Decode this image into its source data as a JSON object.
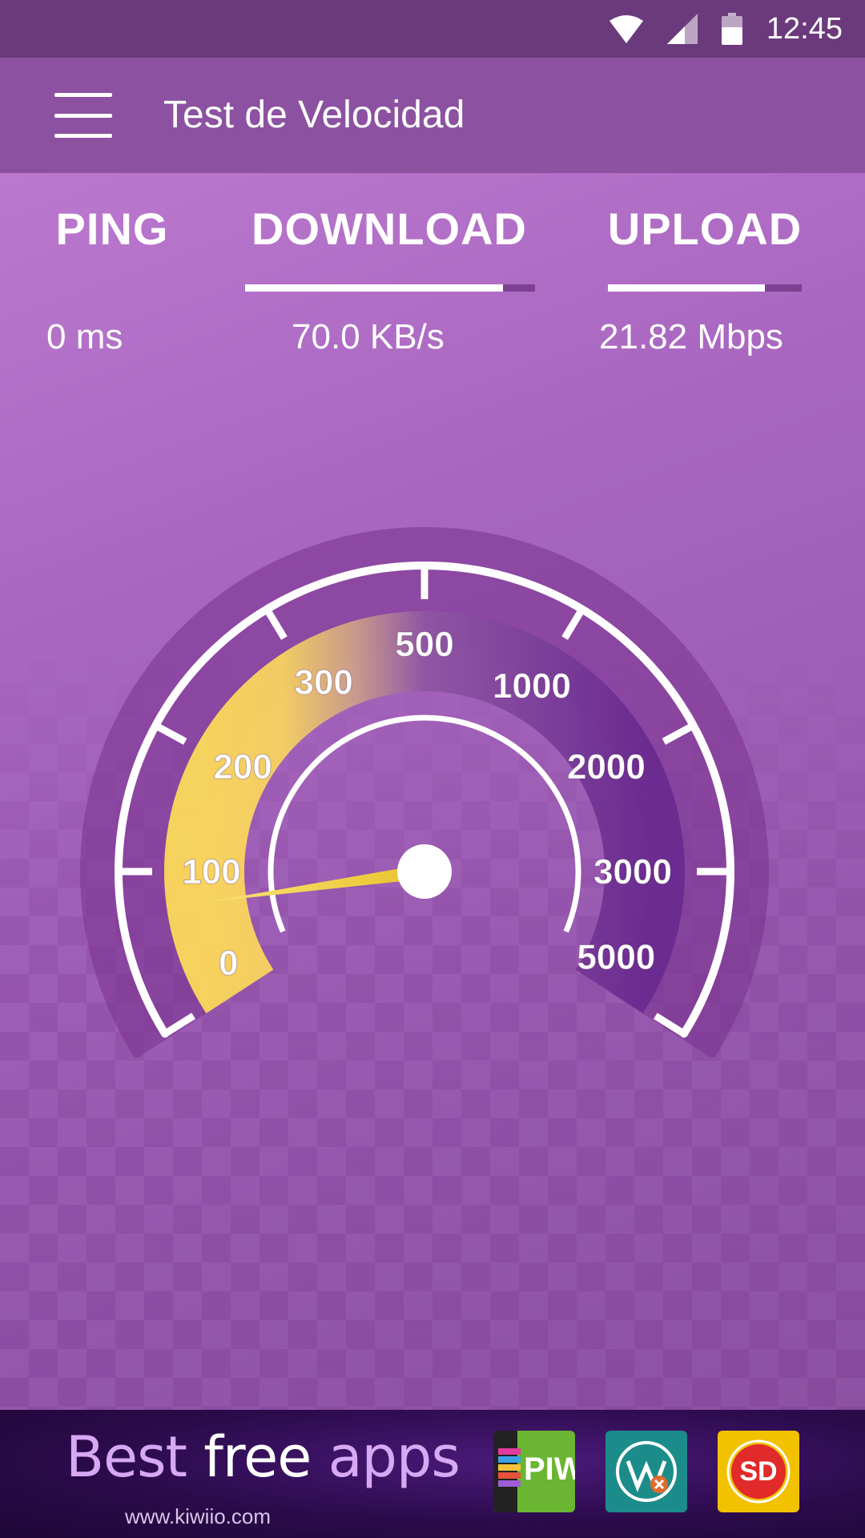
{
  "status_bar": {
    "time": "12:45",
    "icons": [
      "wifi-icon",
      "cell-signal-icon",
      "battery-icon"
    ]
  },
  "app_bar": {
    "title": "Test de Velocidad",
    "menu_icon": "menu-icon"
  },
  "stats": {
    "ping": {
      "label": "PING",
      "value": "0 ms"
    },
    "download": {
      "label": "DOWNLOAD",
      "value": "70.0 KB/s",
      "progress": 0.89
    },
    "upload": {
      "label": "UPLOAD",
      "value": "21.82 Mbps",
      "progress": 0.81
    }
  },
  "gauge": {
    "tick_labels": [
      "0",
      "100",
      "200",
      "300",
      "500",
      "1000",
      "2000",
      "3000",
      "5000"
    ],
    "needle_value_label": "100",
    "colors": {
      "low": "#fcd95a",
      "high": "#6a2a8f",
      "needle": "#f2d43a"
    }
  },
  "ad": {
    "tagline_part1": "Best",
    "tagline_part2": "free",
    "tagline_part3": "apps",
    "url": "www.kiwiio.com",
    "apps": [
      {
        "name": "PIW",
        "bg": "#6ab531"
      },
      {
        "name": "",
        "bg": "#1c8c8a"
      },
      {
        "name": "SD",
        "bg": "#f2c200"
      }
    ]
  }
}
